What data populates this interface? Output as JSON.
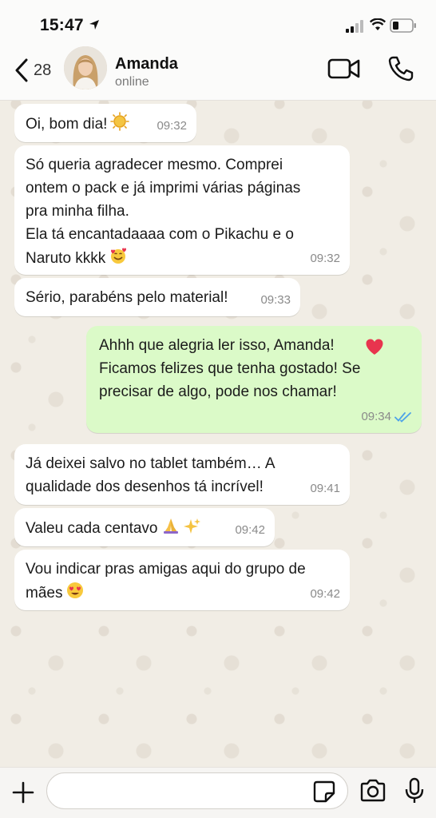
{
  "status_bar": {
    "time": "15:47"
  },
  "header": {
    "back_count": "28",
    "contact_name": "Amanda",
    "contact_status": "online"
  },
  "messages": [
    {
      "direction": "in",
      "text": "Oi, bom dia!",
      "emoji": "sun",
      "time": "09:32"
    },
    {
      "direction": "in",
      "text": "Só queria agradecer mesmo. Comprei\nontem o pack e já imprimi várias páginas\npra minha filha.\nEla tá encantadaaaa com o Pikachu e o\nNaruto kkkk",
      "emoji": "smiling-face-with-hearts",
      "time": "09:32"
    },
    {
      "direction": "in",
      "text": "Sério, parabéns pelo material!",
      "time": "09:33"
    },
    {
      "direction": "out",
      "text": "Ahhh que alegria ler isso, Amanda!\nFicamos felizes que tenha gostado! Se\nprecisar de algo, pode nos chamar!",
      "emoji": "heart",
      "time": "09:34",
      "read": true
    },
    {
      "direction": "in",
      "text": "Já deixei salvo no tablet também… A\nqualidade dos desenhos tá incrível!",
      "time": "09:41"
    },
    {
      "direction": "in",
      "text": "Valeu cada centavo",
      "emoji": "folded-hands-sparkles",
      "time": "09:42"
    },
    {
      "direction": "in",
      "text": "Vou indicar pras amigas aqui do grupo de\nmães",
      "emoji": "heart-eyes",
      "time": "09:42"
    }
  ],
  "composer": {
    "placeholder": ""
  },
  "colors": {
    "incoming_bubble": "#ffffff",
    "outgoing_bubble": "#dbfac8",
    "read_ticks": "#4fa3e8",
    "background": "#efeae2"
  }
}
